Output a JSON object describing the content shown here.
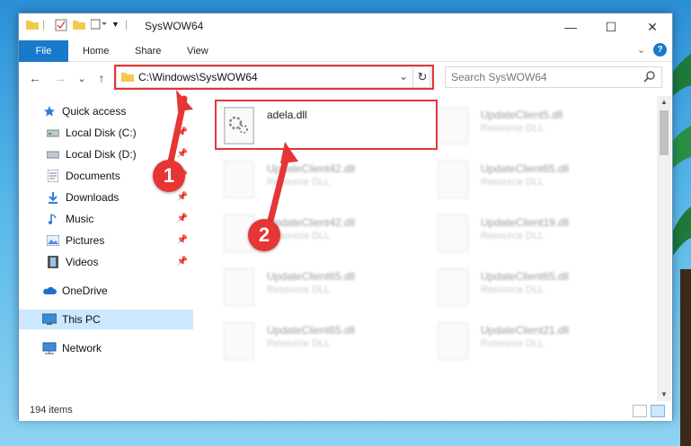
{
  "window": {
    "title": "SysWOW64",
    "minimize": "—",
    "maximize": "☐",
    "close": "✕"
  },
  "ribbon": {
    "tabs": [
      "File",
      "Home",
      "Share",
      "View"
    ],
    "expand": "⌄",
    "help": "?"
  },
  "nav": {
    "back": "←",
    "forward": "→",
    "recent": "⌄",
    "up": "↑",
    "address": "C:\\Windows\\SysWOW64",
    "address_dropdown": "⌄",
    "refresh": "↻",
    "search_placeholder": "Search SysWOW64"
  },
  "sidebar": {
    "items": [
      {
        "label": "Quick access",
        "icon": "star-icon",
        "pinned": false
      },
      {
        "label": "Local Disk (C:)",
        "icon": "drive-icon",
        "pinned": true
      },
      {
        "label": "Local Disk (D:)",
        "icon": "drive-icon",
        "pinned": true
      },
      {
        "label": "Documents",
        "icon": "documents-icon",
        "pinned": true
      },
      {
        "label": "Downloads",
        "icon": "downloads-icon",
        "pinned": true
      },
      {
        "label": "Music",
        "icon": "music-icon",
        "pinned": true
      },
      {
        "label": "Pictures",
        "icon": "pictures-icon",
        "pinned": true
      },
      {
        "label": "Videos",
        "icon": "videos-icon",
        "pinned": true
      },
      {
        "label": "OneDrive",
        "icon": "onedrive-icon",
        "pinned": false
      },
      {
        "label": "This PC",
        "icon": "computer-icon",
        "pinned": false,
        "selected": true
      },
      {
        "label": "Network",
        "icon": "network-icon",
        "pinned": false
      }
    ]
  },
  "files": [
    {
      "name": "adela.dll",
      "type": "",
      "blurred": false
    },
    {
      "name": "UpdateClient5.dll",
      "type": "Resource DLL",
      "blurred": true
    },
    {
      "name": "UpdateClient42.dll",
      "type": "Resource DLL",
      "blurred": true
    },
    {
      "name": "UpdateClient65.dll",
      "type": "Resource DLL",
      "blurred": true
    },
    {
      "name": "UpdateClient42.dll",
      "type": "Resource DLL",
      "blurred": true
    },
    {
      "name": "UpdateClient19.dll",
      "type": "Resource DLL",
      "blurred": true
    },
    {
      "name": "UpdateClient65.dll",
      "type": "Resource DLL",
      "blurred": true
    },
    {
      "name": "UpdateClient65.dll",
      "type": "Resource DLL",
      "blurred": true
    },
    {
      "name": "UpdateClient65.dll",
      "type": "Resource DLL",
      "blurred": true
    },
    {
      "name": "UpdateClient21.dll",
      "type": "Resource DLL",
      "blurred": true
    }
  ],
  "status": {
    "item_count": "194 items"
  },
  "annotations": {
    "step1": "1",
    "step2": "2",
    "color": "#e53535"
  },
  "colors": {
    "accent": "#1979ca",
    "selected": "#cce8ff"
  }
}
